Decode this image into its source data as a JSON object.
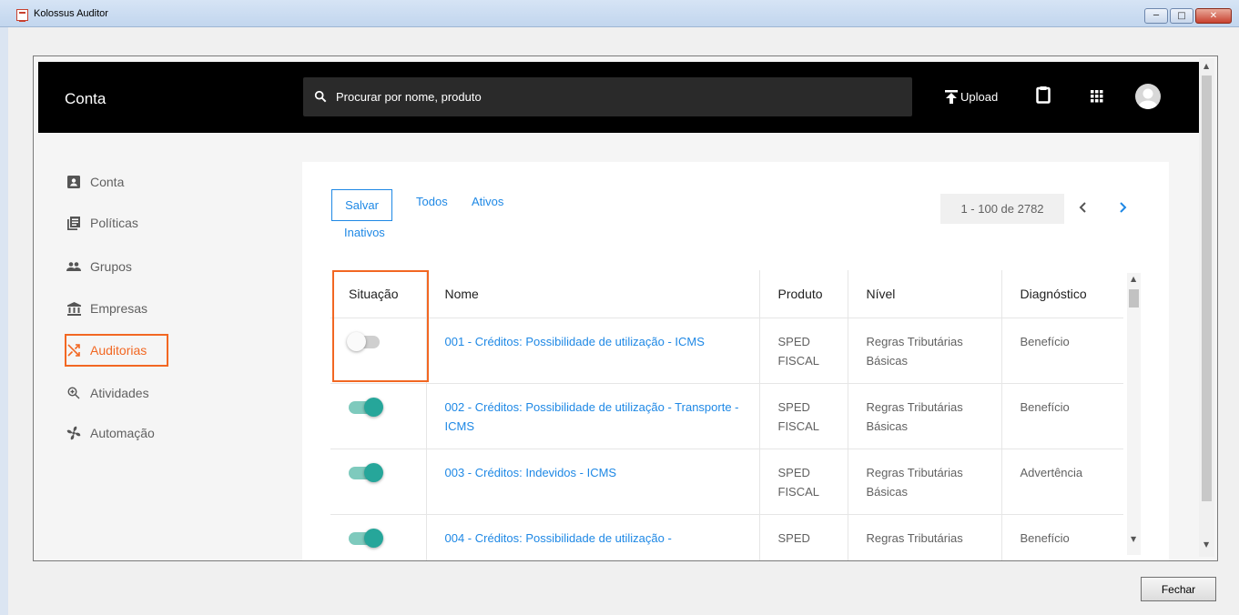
{
  "window": {
    "title": "Kolossus Auditor",
    "close_button": "Fechar"
  },
  "appbar": {
    "title": "Conta",
    "search_placeholder": "Procurar por nome, produto",
    "upload_label": "Upload"
  },
  "sidebar": {
    "items": [
      {
        "label": "Conta",
        "icon": "account-box-icon"
      },
      {
        "label": "Políticas",
        "icon": "library-books-icon"
      },
      {
        "label": "Grupos",
        "icon": "people-icon"
      },
      {
        "label": "Empresas",
        "icon": "bank-icon"
      },
      {
        "label": "Auditorias",
        "icon": "shuffle-icon",
        "active": true
      },
      {
        "label": "Atividades",
        "icon": "zoom-icon"
      },
      {
        "label": "Automação",
        "icon": "fan-icon"
      }
    ]
  },
  "toolbar": {
    "save_label": "Salvar",
    "tabs": [
      "Todos",
      "Ativos",
      "Inativos"
    ],
    "pagination": "1 - 100 de 2782"
  },
  "table": {
    "headers": [
      "Situação",
      "Nome",
      "Produto",
      "Nível",
      "Diagnóstico"
    ],
    "rows": [
      {
        "active": false,
        "nome": "001 - Créditos: Possibilidade de utilização - ICMS",
        "produto": "SPED FISCAL",
        "nivel": "Regras Tributárias Básicas",
        "diagnostico": "Benefício"
      },
      {
        "active": true,
        "nome": "002 - Créditos: Possibilidade de utilização - Transporte - ICMS",
        "produto": "SPED FISCAL",
        "nivel": "Regras Tributárias Básicas",
        "diagnostico": "Benefício"
      },
      {
        "active": true,
        "nome": "003 - Créditos: Indevidos - ICMS",
        "produto": "SPED FISCAL",
        "nivel": "Regras Tributárias Básicas",
        "diagnostico": "Advertência"
      },
      {
        "active": true,
        "nome": "004 - Créditos: Possibilidade de utilização -",
        "produto": "SPED",
        "nivel": "Regras Tributárias",
        "diagnostico": "Benefício"
      }
    ]
  },
  "colors": {
    "accent": "#f26722",
    "link": "#1e88e5",
    "toggle_on": "#26a69a"
  }
}
